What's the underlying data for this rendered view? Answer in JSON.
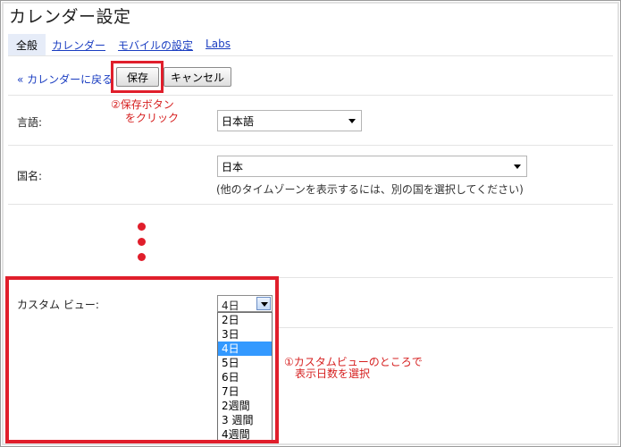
{
  "window": {
    "title": "カレンダー設定"
  },
  "tabs": [
    {
      "label": "全般",
      "active": true
    },
    {
      "label": "カレンダー",
      "active": false
    },
    {
      "label": "モバイルの設定",
      "active": false
    },
    {
      "label": "Labs",
      "active": false
    }
  ],
  "toolbar": {
    "back_label": "« カレンダーに戻る",
    "save_label": "保存",
    "cancel_label": "キャンセル"
  },
  "annotations": {
    "save_line1": "②保存ボタン",
    "save_line2": "をクリック",
    "custom_line1": "①カスタムビューのところで",
    "custom_line2": "表示日数を選択"
  },
  "settings": {
    "language": {
      "label": "言語:",
      "value": "日本語"
    },
    "country": {
      "label": "国名:",
      "value": "日本",
      "hint": "(他のタイムゾーンを表示するには、別の国を選択してください)"
    },
    "custom_view": {
      "label": "カスタム ビュー:",
      "value": "4日",
      "options": [
        "2日",
        "3日",
        "4日",
        "5日",
        "6日",
        "7日",
        "2週間",
        "3 週間",
        "4週間"
      ],
      "selected_index": 2
    }
  },
  "colors": {
    "accent_red": "#e01e2b",
    "link_blue": "#1a3dc1",
    "selection_blue": "#3399ff"
  }
}
